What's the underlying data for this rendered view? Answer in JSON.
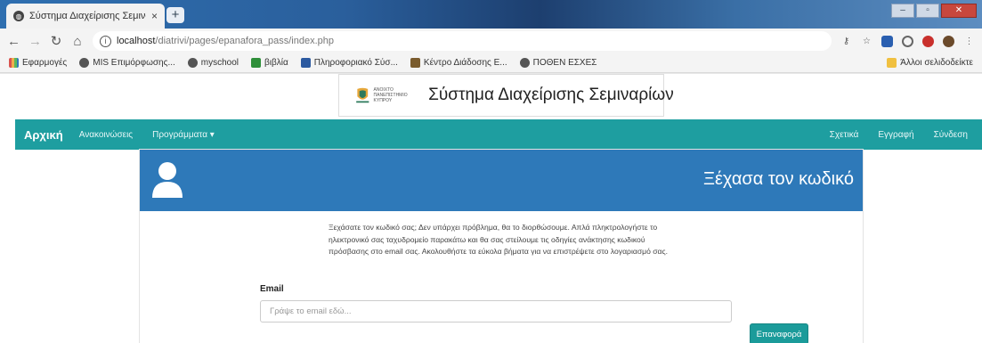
{
  "browser": {
    "tab_title": "Σύστημα Διαχείρισης Σεμιναρί...",
    "tab_close": "×",
    "new_tab": "+",
    "url_host": "localhost",
    "url_path": "/diatrivi/pages/epanafora_pass/index.php",
    "icons": [
      "back-icon",
      "forward-icon",
      "reload-icon",
      "home-icon",
      "info-icon",
      "key-icon",
      "star-icon"
    ]
  },
  "bookmarks": {
    "items": [
      {
        "label": "Εφαρμογές",
        "color": "#d9534f"
      },
      {
        "label": "MIS Επιμόρφωσης...",
        "color": "#555555"
      },
      {
        "label": "myschool",
        "color": "#555555"
      },
      {
        "label": "βιβλία",
        "color": "#2f8f3a"
      },
      {
        "label": "Πληροφοριακό Σύσ...",
        "color": "#2c5aa0"
      },
      {
        "label": "Κέντρο Διάδοσης Ε...",
        "color": "#7a5c2e"
      },
      {
        "label": "ΠΟΘΕΝ ΕΣΧΕΣ",
        "color": "#555555"
      }
    ],
    "other": "Άλλοι σελιδοδείκτε"
  },
  "site": {
    "title": "Σύστημα Διαχείρισης Σεμιναρίων",
    "logo_text": "ΑΝΟΙΧΤΟ ΠΑΝΕΠΙΣΤΗΜΙΟ ΚΥΠΡΟΥ"
  },
  "nav": {
    "home": "Αρχική",
    "announcements": "Ανακοινώσεις",
    "programs": "Προγράμματα ▾",
    "about": "Σχετικά",
    "register": "Εγγραφή",
    "login": "Σύνδεση"
  },
  "panel": {
    "title": "Ξέχασα τον κωδικό",
    "help_text": "Ξεχάσατε τον κωδικό σας; Δεν υπάρχει πρόβλημα, θα το διορθώσουμε. Απλά πληκτρολογήστε το ηλεκτρονικό σας ταχυδρομείο παρακάτω και θα σας στείλουμε τις οδηγίες ανάκτησης κωδικού πρόσβασης στο email σας. Ακολουθήστε τα εύκολα βήματα για να επιστρέψετε στο λογαριασμό σας.",
    "email_label": "Email",
    "email_placeholder": "Γράψε το email εδώ...",
    "email_value": "",
    "submit_label": "Επαναφορά"
  },
  "colors": {
    "navbar": "#1e9ea0",
    "panel_header": "#2e79b9",
    "button": "#1b9b9a"
  }
}
